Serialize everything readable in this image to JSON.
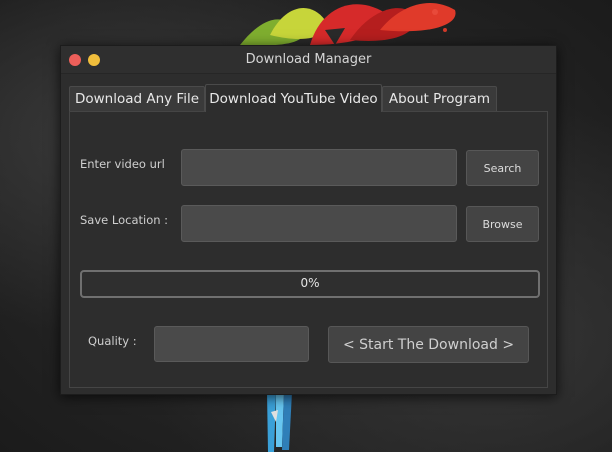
{
  "window": {
    "title": "Download Manager"
  },
  "tabs": [
    {
      "label": "Download Any File",
      "active": false
    },
    {
      "label": "Download YouTube Video",
      "active": true
    },
    {
      "label": "About Program",
      "active": false
    }
  ],
  "form": {
    "url_label": "Enter video url",
    "url_value": "",
    "search_label": "Search",
    "location_label": "Save Location :",
    "location_value": "",
    "browse_label": "Browse",
    "progress_text": "0%",
    "progress_value": 0,
    "quality_label": "Quality :",
    "quality_value": "",
    "start_label": "< Start The Download >"
  },
  "colors": {
    "close": "#ed5f5a",
    "minimize": "#f0be3c",
    "window_bg": "#2d2d2d",
    "field_bg": "#4a4a4a"
  }
}
